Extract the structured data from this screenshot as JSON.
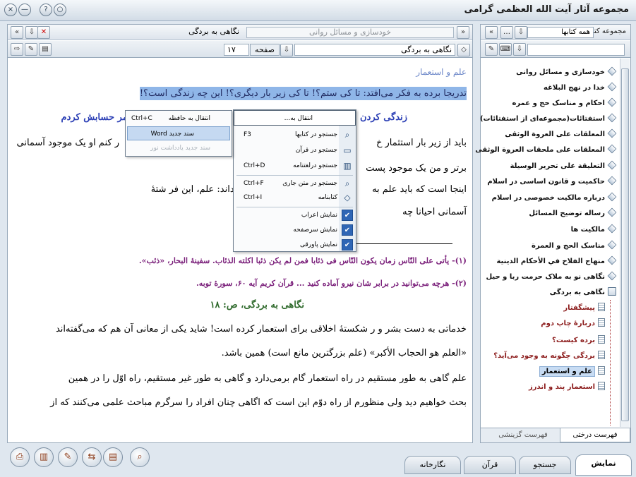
{
  "window": {
    "title": "مجموعه آثار آیت الله العظمی گرامی",
    "buttons": [
      "○",
      "?",
      "—",
      "×"
    ]
  },
  "doc_toolbar": {
    "doc_title": "نگاهی به بردگی",
    "category_path": "خودسازی و مسائل روانی",
    "book_name": "نگاهی به بردگی",
    "page_label": "صفحه",
    "page_number": "۱۷"
  },
  "tree_toolbar": {
    "title": "مجموعه کتب",
    "filter_value": "همه کتابها"
  },
  "document": {
    "heading": "علم و استعمار",
    "selected_line": "تدریجا برده به فکر می‌افتد: تا کی ستم؟! تا کی زیر بار دیگری؟! این چه زندگی است؟!",
    "subheading_right": "زندگی کردن من",
    "subheading_left": "عمر حسابش کردم",
    "lines": [
      "باید از زیر بار استثمار خ",
      "برتر و من یک موجود پست",
      "اینجا است که باید علم به",
      "آسمانی احیانا چه"
    ],
    "lines_left": [
      "ر کنم او یک موجود آسمانی",
      "ری خود را انجام دهد که خدا می‌داند: علم، این فر شتهٔ"
    ],
    "footnote1": "(۱)- یأتی علی النّاس زمان یکون النّاس فی ذئابا فمن لم یکن ذئبا اکلته الذئاب. سفینهٔ البحار، «ذئب».",
    "footnote2": "(۲)- هرچه می‌توانید در برابر شان نیرو آماده کنید ... قرآن کریم آیه ۶۰، سورهٔ توبه.",
    "page_ref": "نگاهی به بردگی، ص: ۱۸",
    "para1": "خدماتی به دست بشر و ر شکستهٔ اخلاقی برای استعمار کرده است! شاید یکی از معانی آن هم که می‌گفته‌اند",
    "para2": "«العلم هو الحجاب الأكبر» (علم بزرگترین مانع است) همین باشد.",
    "para3": "علم گاهی به طور مستقیم در راه استعمار گام برمی‌دارد و گاهی به طور غیر مستقیم، راه اوّل را در همین",
    "para4": "بحث خواهیم دید ولی منظورم از راه دوّم این است که اگاهی چنان افراد را سرگرم مباحث علمی می‌کنند که از"
  },
  "context_menu": {
    "header": "انتقال به...",
    "items": [
      {
        "label": "جستجو در کتابها",
        "shortcut": "F3",
        "icon": "search-icon"
      },
      {
        "label": "جستجو در قرآن",
        "shortcut": "",
        "icon": "quran-icon"
      },
      {
        "label": "جستجو درلغتنامه",
        "shortcut": "Ctrl+D",
        "icon": "dictionary-icon"
      },
      {
        "label": "جستجو در متن جاری",
        "shortcut": "Ctrl+F",
        "icon": "find-icon"
      },
      {
        "label": "کتابنامه",
        "shortcut": "Ctrl+I",
        "icon": "diamond-icon"
      },
      {
        "label": "نمایش اعراب",
        "checked": true
      },
      {
        "label": "نمایش سرصفحه",
        "checked": true
      },
      {
        "label": "نمایش پاورقی",
        "checked": true
      }
    ],
    "check_glyph": "✔"
  },
  "submenu": {
    "items": [
      {
        "label": "انتقال به حافظه",
        "shortcut": "Ctrl+C"
      },
      {
        "label": "سند جدید Word",
        "shortcut": ""
      },
      {
        "label": "سند جدید یادداشت نور",
        "shortcut": ""
      }
    ]
  },
  "tree": {
    "items": [
      "خودسازی و مسائل روانی",
      "خدا در نهج البلاغه",
      "احکام و مناسک حج و عمره",
      "استفتائات(مجموعه‌ای از استفتائات)",
      "المعلقات علی العروة الوثقی",
      "المعلقات علی ملحقات العروة الوثقی",
      "التعلیقة علی تحریر الوسیلة",
      "حاکمیت و قانون اساسی در اسلام",
      "درباره مالکیت خصوصی در اسلام",
      "رساله توضیح المسائل",
      "مالکیت ها",
      "مناسک الحج و العمرة",
      "منهاج الفلاح في الأحكام الدينية",
      "نگاهی نو به ملاک حرمت ربا و حیل",
      "نگاهی به بردگی"
    ],
    "children": [
      "پیشگفتار",
      "دربارهٔ چاپ دوم",
      "برده کیست؟",
      "بردگی چگونه به وجود می‌آید؟",
      "علم و استعمار",
      "استعمار پند و اندرز"
    ],
    "tabs": [
      "فهرست درختی",
      "فهرست گزینشی"
    ]
  },
  "bottom_tabs": [
    "نمایش",
    "جستجو",
    "قرآن",
    "نگارخانه"
  ]
}
